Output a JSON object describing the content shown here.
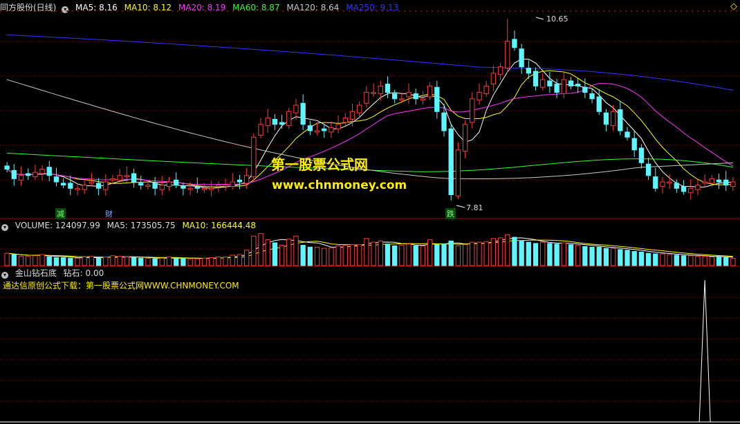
{
  "colors": {
    "up": "#ff3b3b",
    "down": "#5ff5ff",
    "ma5": "#ffffff",
    "ma10": "#ffff00",
    "ma20": "#ff33ff",
    "ma60": "#33ff33",
    "ma120": "#c8c8c8",
    "ma250": "#3333ff",
    "grid": "#8b0000"
  },
  "header": {
    "title": "同方股份(日线)",
    "ma5": "MA5: 8.16",
    "ma10": "MA10: 8.12",
    "ma20": "MA20: 8.19",
    "ma60": "MA60: 8.87",
    "ma120": "MA120: 8.64",
    "ma250": "MA250: 9.13"
  },
  "volume_header": {
    "label": "VOLUME: 124097.99",
    "ma5": "MA5: 173505.75",
    "ma10": "MA10: 166444.48"
  },
  "indicator_header": {
    "label": "金山钻石底",
    "value": "钻石: 0.00",
    "note": "通达信原创公式下载：第一股票公式网WWW.CHNMONEY.COM"
  },
  "watermark": {
    "line1": "第一股票公式网",
    "line2": "www.chnmoney.com"
  },
  "markers": {
    "reduce": "减",
    "wealth": "财",
    "fall": "跌",
    "high": "10.65",
    "low": "7.81"
  },
  "chart_data": {
    "type": "candlestick",
    "title": "同方股份(日线)",
    "y_range": [
      7.7,
      10.75
    ],
    "high_label": 10.65,
    "low_label": 7.81,
    "close": [
      8.3,
      8.15,
      8.2,
      8.2,
      8.25,
      8.3,
      8.2,
      8.1,
      8.05,
      8.0,
      8.0,
      8.05,
      8.1,
      8.0,
      8.1,
      8.15,
      8.2,
      8.2,
      8.1,
      8.05,
      8.05,
      8.0,
      8.05,
      8.1,
      8.05,
      8.0,
      8.0,
      8.0,
      8.0,
      8.0,
      8.05,
      8.05,
      8.1,
      8.1,
      8.2,
      8.8,
      9.0,
      9.1,
      9.0,
      9.0,
      9.2,
      9.3,
      9.0,
      8.9,
      8.9,
      8.9,
      8.95,
      9.0,
      9.1,
      9.2,
      9.3,
      9.5,
      9.5,
      9.6,
      9.5,
      9.4,
      9.4,
      9.5,
      9.4,
      9.4,
      9.6,
      9.2,
      8.9,
      7.9,
      8.6,
      9.0,
      9.4,
      9.5,
      9.6,
      9.8,
      9.9,
      10.3,
      10.2,
      9.9,
      9.8,
      9.6,
      9.7,
      9.6,
      9.5,
      9.7,
      9.6,
      9.6,
      9.5,
      9.4,
      9.2,
      9.0,
      9.2,
      8.9,
      8.8,
      8.6,
      8.4,
      8.2,
      8.0,
      8.1,
      8.1,
      8.0,
      7.95,
      8.0,
      8.05,
      8.1,
      8.15,
      8.1,
      8.05,
      8.1
    ],
    "volume": [
      2.0,
      1.8,
      1.5,
      1.5,
      1.6,
      1.8,
      1.4,
      1.3,
      1.3,
      1.2,
      1.2,
      1.4,
      1.5,
      1.2,
      1.4,
      1.6,
      1.5,
      1.4,
      1.3,
      1.2,
      1.2,
      1.1,
      1.2,
      1.4,
      1.2,
      1.2,
      1.1,
      1.1,
      1.2,
      1.3,
      1.4,
      1.4,
      1.7,
      1.8,
      2.5,
      4.8,
      5.2,
      4.2,
      3.7,
      3.3,
      4.3,
      4.8,
      3.3,
      3.0,
      3.0,
      2.8,
      2.9,
      3.2,
      3.3,
      3.4,
      3.4,
      4.4,
      3.8,
      4.0,
      3.5,
      3.2,
      3.3,
      3.5,
      3.2,
      3.2,
      4.2,
      3.4,
      3.5,
      4.0,
      3.2,
      3.4,
      3.8,
      3.8,
      3.9,
      4.4,
      4.5,
      5.0,
      4.6,
      4.0,
      3.8,
      3.6,
      3.8,
      3.6,
      3.5,
      3.7,
      3.4,
      3.3,
      3.1,
      3.0,
      3.0,
      2.8,
      2.8,
      2.6,
      2.5,
      2.3,
      2.2,
      2.0,
      1.9,
      1.9,
      1.8,
      1.7,
      1.6,
      1.6,
      1.5,
      1.5,
      1.4,
      1.4,
      1.3,
      1.2
    ],
    "indicator_spike_index": 99
  }
}
